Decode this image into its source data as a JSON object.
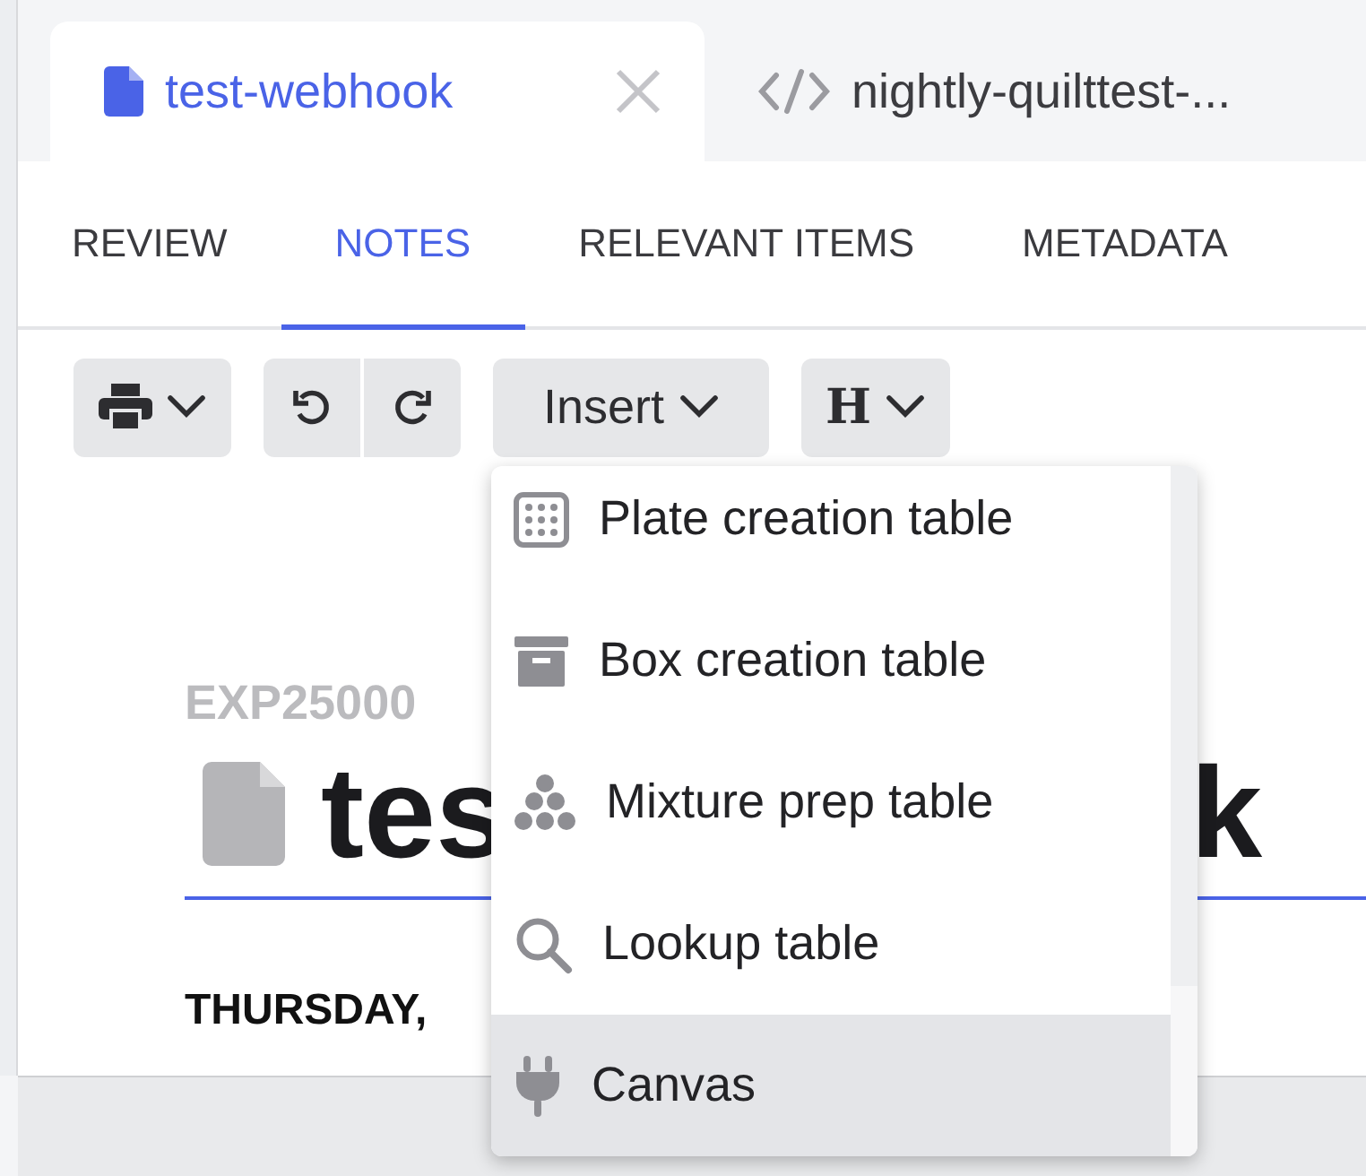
{
  "document_tabs": [
    {
      "label": "test-webhook",
      "kind": "document",
      "selected": true
    },
    {
      "label": "nightly-quilttest-...",
      "kind": "code",
      "selected": false
    }
  ],
  "section_tabs": [
    {
      "label": "REVIEW",
      "selected": false
    },
    {
      "label": "NOTES",
      "selected": true
    },
    {
      "label": "RELEVANT ITEMS",
      "selected": false
    },
    {
      "label": "METADATA",
      "selected": false
    }
  ],
  "toolbar": {
    "insert_label": "Insert",
    "heading_label": "H"
  },
  "document": {
    "id_visible": "EXP25000",
    "title_visible_start": "tes",
    "title_visible_end": "k",
    "date_visible": "THURSDAY,"
  },
  "insert_menu": [
    {
      "label": "Plate creation table",
      "kind": "plate",
      "highlighted": false
    },
    {
      "label": "Box creation table",
      "kind": "box",
      "highlighted": false
    },
    {
      "label": "Mixture prep table",
      "kind": "mixture",
      "highlighted": false
    },
    {
      "label": "Lookup table",
      "kind": "lookup",
      "highlighted": false
    },
    {
      "label": "Canvas",
      "kind": "canvas",
      "highlighted": true
    }
  ]
}
